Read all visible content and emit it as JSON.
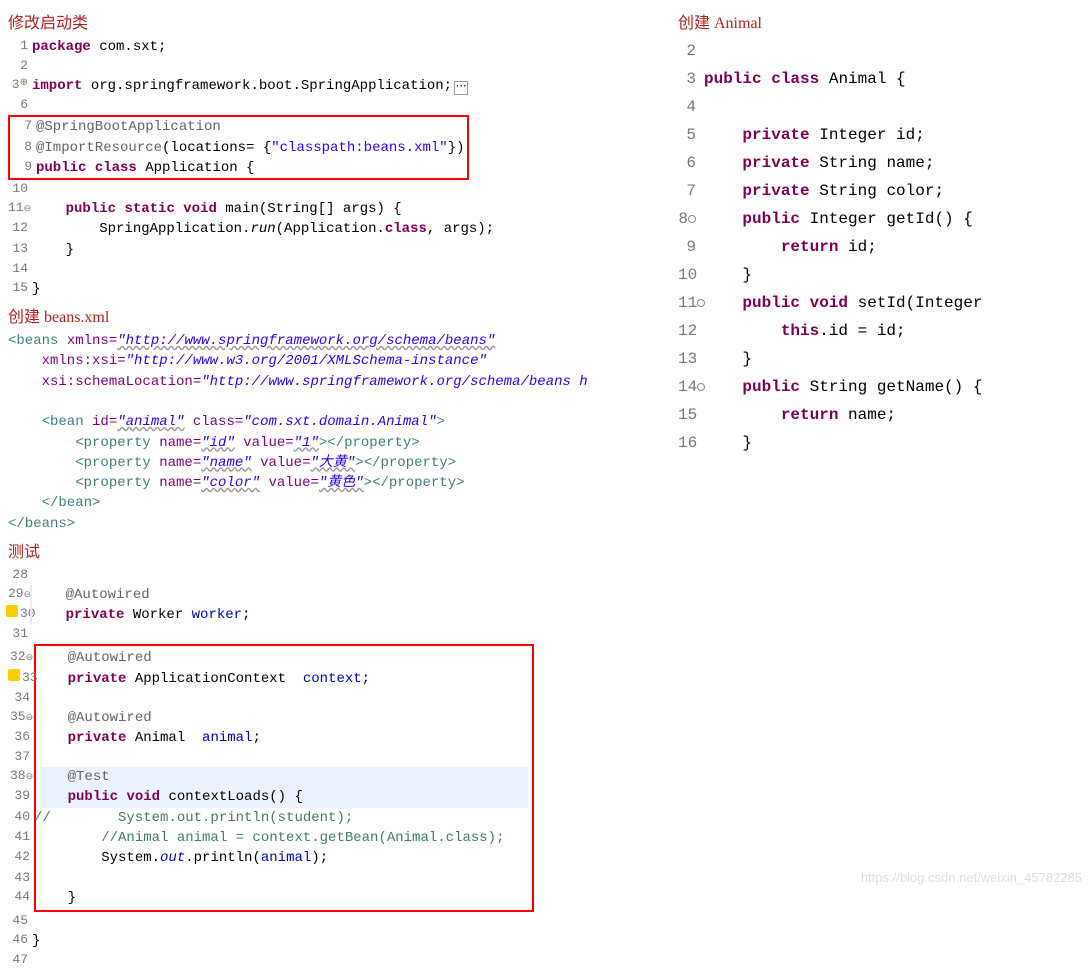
{
  "sections": {
    "modify_startup": "修改启动类",
    "create_beans": "创建 beans.xml",
    "test": "测试",
    "create_animal": "创建 Animal"
  },
  "app_code": {
    "l1": " package com.sxt;",
    "l3_kw": "import",
    "l3_pkg": " org.springframework.boot.SpringApplication;",
    "l7": "@SpringBootApplication",
    "l8_ann": "@ImportResource",
    "l8_rest": "(locations= {",
    "l8_str": "\"classpath:beans.xml\"",
    "l8_end": "})",
    "l9_kw1": "public",
    "l9_kw2": "class",
    "l9_name": " Application {",
    "l11_kw1": "public",
    "l11_kw2": "static",
    "l11_kw3": "void",
    "l11_name": " main(String[] args) {",
    "l12a": "        SpringApplication.",
    "l12_run": "run",
    "l12b": "(Application.",
    "l12_class": "class",
    "l12c": ", args);",
    "l13": "    }",
    "l15": "}"
  },
  "xml": {
    "l1a": "<beans",
    "l1b": " xmlns=",
    "l1v": "\"http://www.springframework.org/schema/beans\"",
    "l2a": "    xmlns:xsi=",
    "l2v": "\"http://www.w3.org/2001/XMLSchema-instance\"",
    "l3a": "    xsi:schemaLocation=",
    "l3v": "\"http://www.springframework.org/schema/beans h",
    "l5a": "    <bean",
    "l5b": " id=",
    "l5v1": "\"animal\"",
    "l5c": " class=",
    "l5v2": "\"com.sxt.domain.Animal\"",
    "l5d": ">",
    "l6a": "        <property",
    "l6b": " name=",
    "l6v1": "\"id\"",
    "l6c": " value=",
    "l6v2": "\"1\"",
    "l6d": "></property>",
    "l7v1": "\"name\"",
    "l7v2": "\"大黄\"",
    "l8v1": "\"color\"",
    "l8v2": "\"黄色\"",
    "l9": "    </bean>",
    "l10": "</beans>"
  },
  "test_code": {
    "l29": "@Autowired",
    "l30_kw": "private",
    "l30_type": " Worker ",
    "l30_var": "worker",
    "l30_end": ";",
    "l32": "@Autowired",
    "l33_kw": "private",
    "l33_type": " ApplicationContext  ",
    "l33_var": "context",
    "l33_end": ";",
    "l35": "@Autowired",
    "l36_kw": "private",
    "l36_type": " Animal  ",
    "l36_var": "animal",
    "l36_end": ";",
    "l38": "@Test",
    "l39_kw1": "public",
    "l39_kw2": "void",
    "l39_name": " contextLoads() {",
    "l40": "//        System.out.println(student);",
    "l41": "        //Animal animal = context.getBean(Animal.class);",
    "l42a": "        System.",
    "l42_out": "out",
    "l42b": ".println(",
    "l42_var": "animal",
    "l42c": ");",
    "l44": "    }",
    "l46": "}"
  },
  "animal_code": {
    "l3_kw1": "public",
    "l3_kw2": "class",
    "l3_name": " Animal {",
    "l5_kw": "private",
    "l5_type": " Integer id;",
    "l6_kw": "private",
    "l6_type": " String name;",
    "l7_kw": "private",
    "l7_type": " String color;",
    "l8_kw": "public",
    "l8_rest": " Integer getId() {",
    "l9_kw": "return",
    "l9_rest": " id;",
    "l10": "}",
    "l11_kw1": "public",
    "l11_kw2": "void",
    "l11_rest": " setId(Integer",
    "l12_kw": "this",
    "l12_rest": ".id = id;",
    "l13": "}",
    "l14_kw": "public",
    "l14_rest": " String getName() {",
    "l15_kw": "return",
    "l15_rest": " name;",
    "l16": "}"
  },
  "watermark": "https://blog.csdn.net/weixin_45782285"
}
